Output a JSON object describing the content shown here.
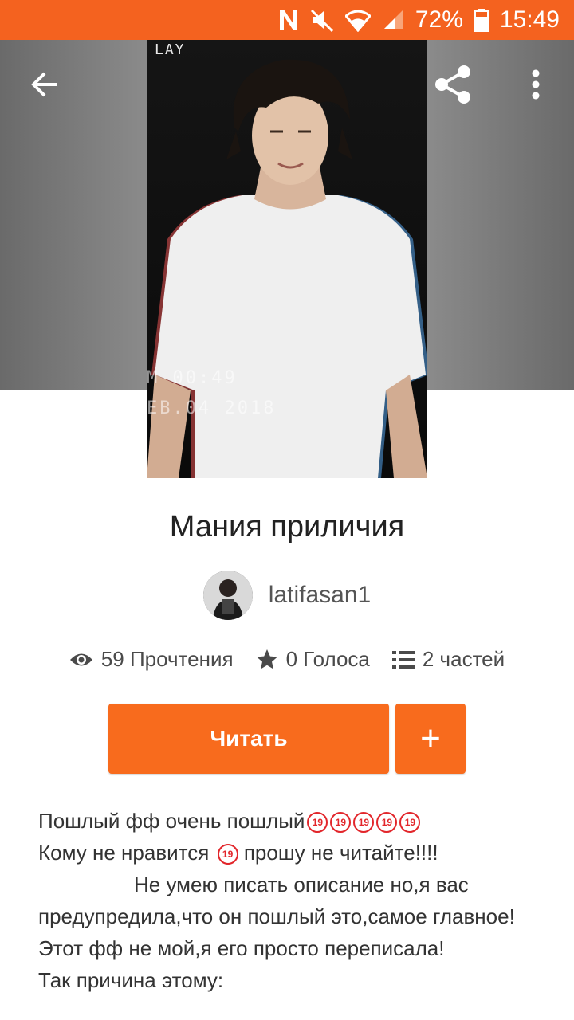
{
  "status_bar": {
    "battery_percent": "72%",
    "time": "15:49",
    "icons": [
      "nfc-icon",
      "mute-icon",
      "wifi-icon",
      "signal-icon",
      "battery-icon"
    ]
  },
  "story": {
    "title": "Мания приличия",
    "author": "latifasan1",
    "cover_text": {
      "top": "LAY",
      "time": "M 00:49",
      "date": "EB.04 2018"
    },
    "stats": {
      "reads": "59 Прочтения",
      "votes": "0 Голоса",
      "parts": "2 частей"
    },
    "read_label": "Читать",
    "add_label": "+",
    "description": {
      "line1": "Пошлый фф очень пошлый",
      "line2_a": "Кому не нравится",
      "line2_b": "прошу не читайте!!!!",
      "line3": "Не умею писать описание но,я вас предупредила,что он пошлый это,самое главное!",
      "line4": "Этот фф не мой,я его просто переписала!",
      "line5": "Так причина этому:",
      "badge_text": "19"
    }
  },
  "colors": {
    "accent": "#f86b1d",
    "statusbar": "#f4621f",
    "badge": "#e2262b"
  }
}
